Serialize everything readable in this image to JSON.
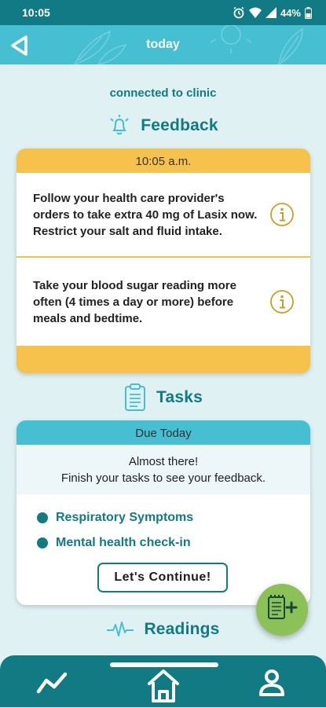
{
  "status_bar": {
    "time": "10:05",
    "battery": "44%"
  },
  "header": {
    "title": "today"
  },
  "connection_status": "connected to clinic",
  "feedback": {
    "heading": "Feedback",
    "time": "10:05 a.m.",
    "items": [
      {
        "text": "Follow your health care provider's orders to take extra 40 mg of Lasix now. Restrict your salt and fluid intake."
      },
      {
        "text": "Take your blood sugar reading more often (4 times a day or more) before meals and bedtime."
      }
    ]
  },
  "tasks": {
    "heading": "Tasks",
    "due_label": "Due Today",
    "message_line1": "Almost there!",
    "message_line2": "Finish your tasks to see your feedback.",
    "items": [
      {
        "label": "Respiratory Symptoms"
      },
      {
        "label": "Mental health check-in"
      }
    ],
    "continue_label": "Let's Continue!"
  },
  "readings": {
    "heading": "Readings"
  },
  "colors": {
    "primary": "#117a82",
    "header": "#46bfd3",
    "feedback_accent": "#f6c24b",
    "fab": "#8cc158",
    "background": "#dff1f3"
  },
  "icons": {
    "back": "back-arrow-icon",
    "feedback": "bell-icon",
    "info": "info-icon",
    "tasks": "clipboard-icon",
    "readings": "pulse-icon",
    "fab": "add-note-icon",
    "nav": [
      "trend-icon",
      "home-icon",
      "profile-icon"
    ]
  }
}
